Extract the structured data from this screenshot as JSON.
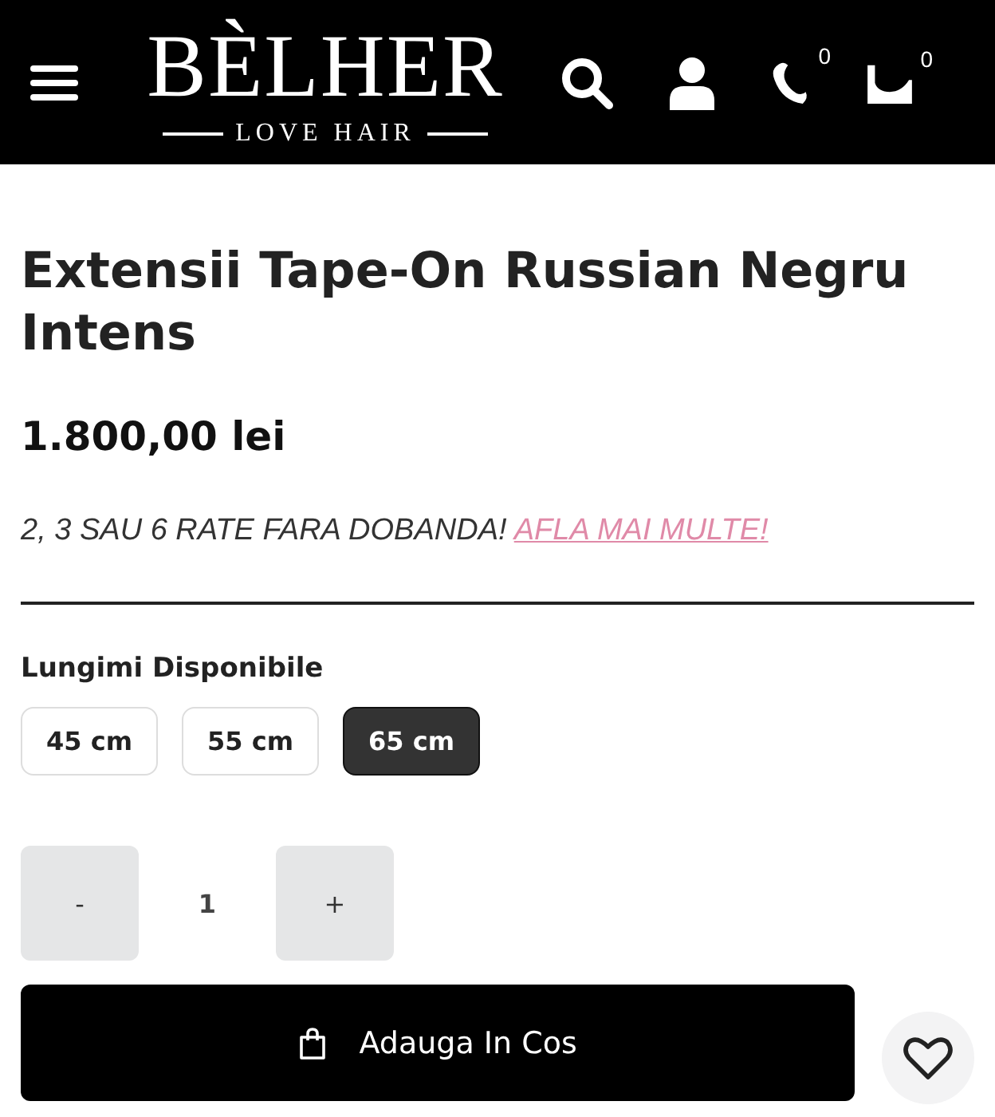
{
  "header": {
    "logo": "BÈLHER",
    "tagline": "LOVE HAIR",
    "wishlist_count": "0",
    "cart_count": "0"
  },
  "product": {
    "title": "Extensii Tape-On Russian Negru Intens",
    "price": "1.800,00 lei",
    "installments": "2, 3 SAU 6 RATE FARA DOBANDA!",
    "installments_link": "AFLA MAI MULTE!"
  },
  "lengths": {
    "label": "Lungimi Disponibile",
    "options": [
      {
        "label": "45 cm",
        "selected": false
      },
      {
        "label": "55 cm",
        "selected": false
      },
      {
        "label": "65 cm",
        "selected": true
      }
    ]
  },
  "quantity": {
    "minus": "-",
    "value": "1",
    "plus": "+"
  },
  "add_to_cart": "Adauga In Cos"
}
